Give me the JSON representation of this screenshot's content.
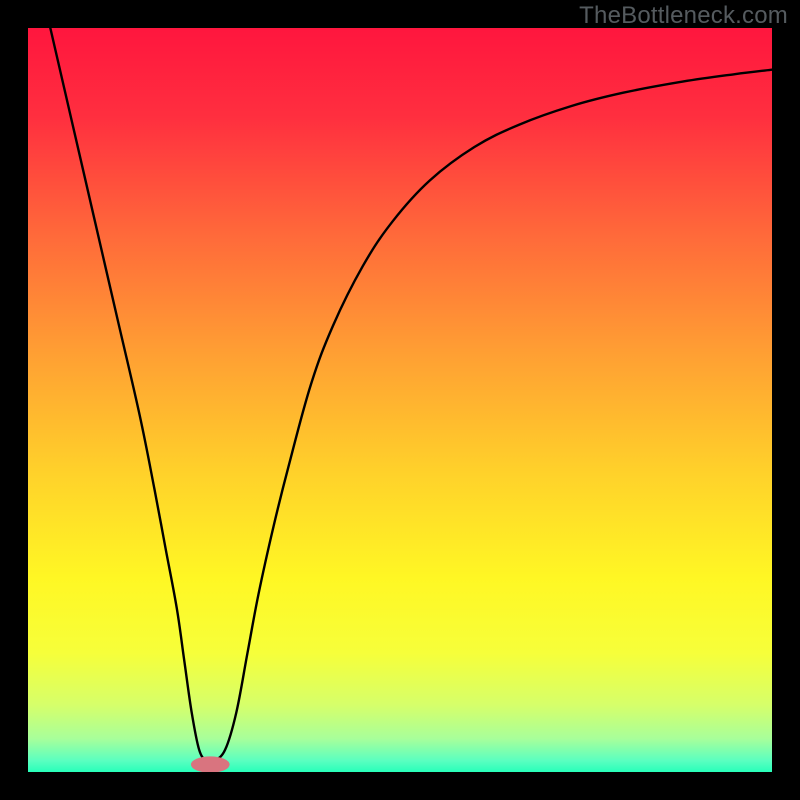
{
  "watermark": "TheBottleneck.com",
  "chart_data": {
    "type": "line",
    "title": "",
    "xlabel": "",
    "ylabel": "",
    "xlim": [
      0,
      100
    ],
    "ylim": [
      0,
      100
    ],
    "grid": false,
    "legend": false,
    "background_gradient": {
      "stops": [
        {
          "offset": 0.0,
          "color": "#ff163e"
        },
        {
          "offset": 0.12,
          "color": "#ff2f3f"
        },
        {
          "offset": 0.28,
          "color": "#ff6a3a"
        },
        {
          "offset": 0.44,
          "color": "#ffa033"
        },
        {
          "offset": 0.6,
          "color": "#ffd22a"
        },
        {
          "offset": 0.74,
          "color": "#fff724"
        },
        {
          "offset": 0.84,
          "color": "#f6ff3a"
        },
        {
          "offset": 0.91,
          "color": "#d6ff6a"
        },
        {
          "offset": 0.955,
          "color": "#a8ff9a"
        },
        {
          "offset": 0.985,
          "color": "#5affc0"
        },
        {
          "offset": 1.0,
          "color": "#28ffba"
        }
      ]
    },
    "series": [
      {
        "name": "bottleneck-curve",
        "color": "#000000",
        "x": [
          3,
          6,
          9,
          12,
          15,
          17,
          18.5,
          20,
          21,
          22,
          23,
          24,
          25,
          26.5,
          28,
          29.5,
          31,
          33,
          35,
          38,
          41,
          45,
          49,
          54,
          60,
          66,
          73,
          80,
          88,
          95,
          100
        ],
        "y": [
          100,
          87,
          74,
          61,
          48,
          38,
          30,
          22,
          15,
          8,
          3,
          1.5,
          1.5,
          3,
          8,
          16,
          24,
          33,
          41,
          52,
          60,
          68,
          74,
          79.5,
          84,
          87,
          89.5,
          91.3,
          92.8,
          93.8,
          94.4
        ]
      }
    ],
    "marker": {
      "name": "optimal-point",
      "cx": 24.5,
      "cy": 1.0,
      "rx": 2.6,
      "ry": 1.1,
      "color": "#d9747f"
    }
  }
}
